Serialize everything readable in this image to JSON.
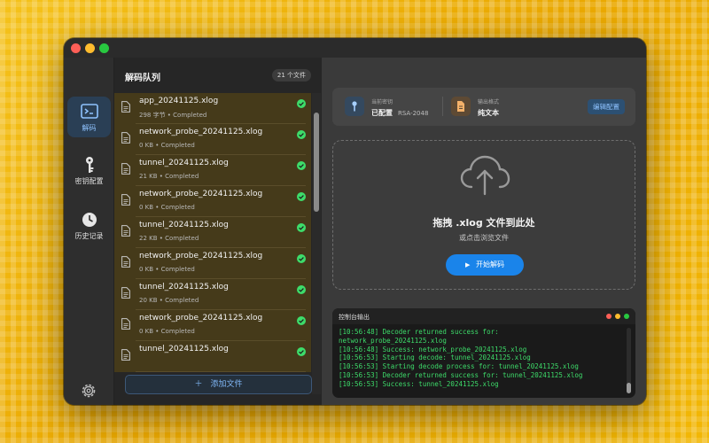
{
  "sidebar": {
    "items": [
      {
        "label": "解码",
        "icon": "terminal-icon",
        "active": true
      },
      {
        "label": "密钥配置",
        "icon": "key-icon",
        "active": false
      },
      {
        "label": "历史记录",
        "icon": "clock-icon",
        "active": false
      }
    ],
    "settings_icon": "gear-icon"
  },
  "queue": {
    "title": "解码队列",
    "count": "21 个文件",
    "files": [
      {
        "name": "app_20241125.xlog",
        "meta": "298 字节 • Completed"
      },
      {
        "name": "network_probe_20241125.xlog",
        "meta": "0 KB • Completed"
      },
      {
        "name": "tunnel_20241125.xlog",
        "meta": "21 KB • Completed"
      },
      {
        "name": "network_probe_20241125.xlog",
        "meta": "0 KB • Completed"
      },
      {
        "name": "tunnel_20241125.xlog",
        "meta": "22 KB • Completed"
      },
      {
        "name": "network_probe_20241125.xlog",
        "meta": "0 KB • Completed"
      },
      {
        "name": "tunnel_20241125.xlog",
        "meta": "20 KB • Completed"
      },
      {
        "name": "network_probe_20241125.xlog",
        "meta": "0 KB • Completed"
      },
      {
        "name": "tunnel_20241125.xlog",
        "meta": ""
      }
    ],
    "add_button": "添加文件"
  },
  "config": {
    "key_label": "当前密钥",
    "key_value": "已配置",
    "key_algo": "RSA-2048",
    "format_label": "输出格式",
    "format_value": "纯文本",
    "edit_button": "编辑配置"
  },
  "dropzone": {
    "title": "拖拽 .xlog 文件到此处",
    "subtitle": "或点击浏览文件",
    "start_button": "开始解码"
  },
  "console": {
    "title": "控制台输出",
    "lines": [
      "[10:56:48] Decoder returned success for:",
      "network_probe_20241125.xlog",
      "[10:56:48] Success: network_probe_20241125.xlog",
      "[10:56:53] Starting decode: tunnel_20241125.xlog",
      "[10:56:53] Starting decode process for: tunnel_20241125.xlog",
      "[10:56:53] Decoder returned success for: tunnel_20241125.xlog",
      "[10:56:53] Success: tunnel_20241125.xlog"
    ]
  },
  "colors": {
    "accent": "#1a84ea",
    "success": "#3ddc6a",
    "queue_item_bg": "#453a1a"
  }
}
